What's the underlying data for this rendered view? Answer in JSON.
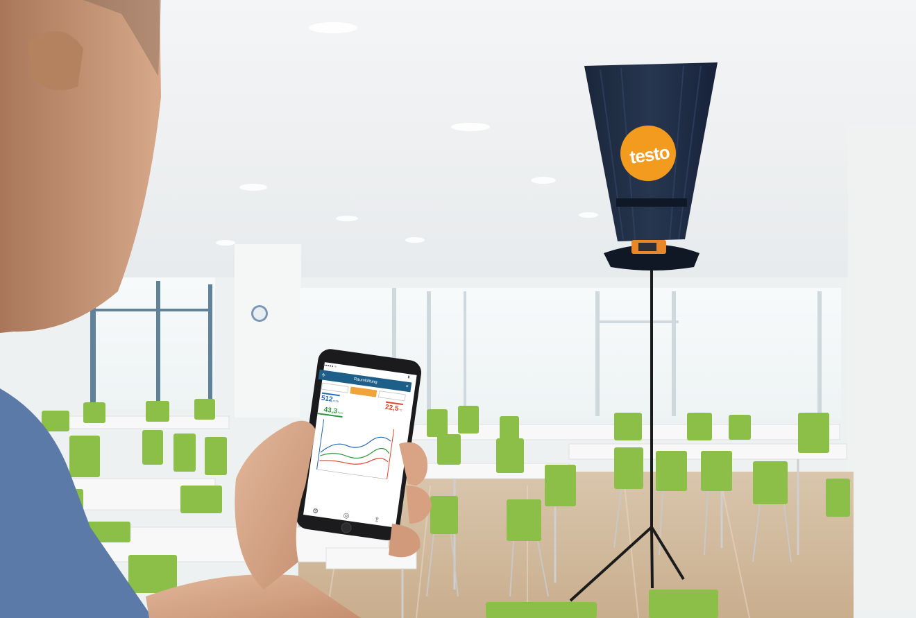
{
  "logo": {
    "text": "testo"
  },
  "phone": {
    "status_left": "●●●●● ≈",
    "status_right": "▮",
    "title": "Raumlüftung",
    "menu_icon": "menu-icon",
    "app_icon": "fan-icon",
    "tabs": [
      "",
      "",
      ""
    ],
    "active_tab": 1,
    "readings": {
      "flow": {
        "value": "512",
        "unit": "m³/h"
      },
      "temp": {
        "value": "22,5",
        "unit": "°C"
      },
      "humidity": {
        "value": "43,3",
        "unit": "%rH"
      }
    },
    "bottom_icons": [
      "gear-icon",
      "record-icon",
      "share-icon"
    ]
  },
  "colors": {
    "testo_orange": "#f39b1f",
    "hood_fabric": "#1d2a3f",
    "chair_green": "#7fb43c",
    "accent_blue": "#1f66b5",
    "accent_red": "#e0452a",
    "accent_green": "#2d9a3e"
  }
}
